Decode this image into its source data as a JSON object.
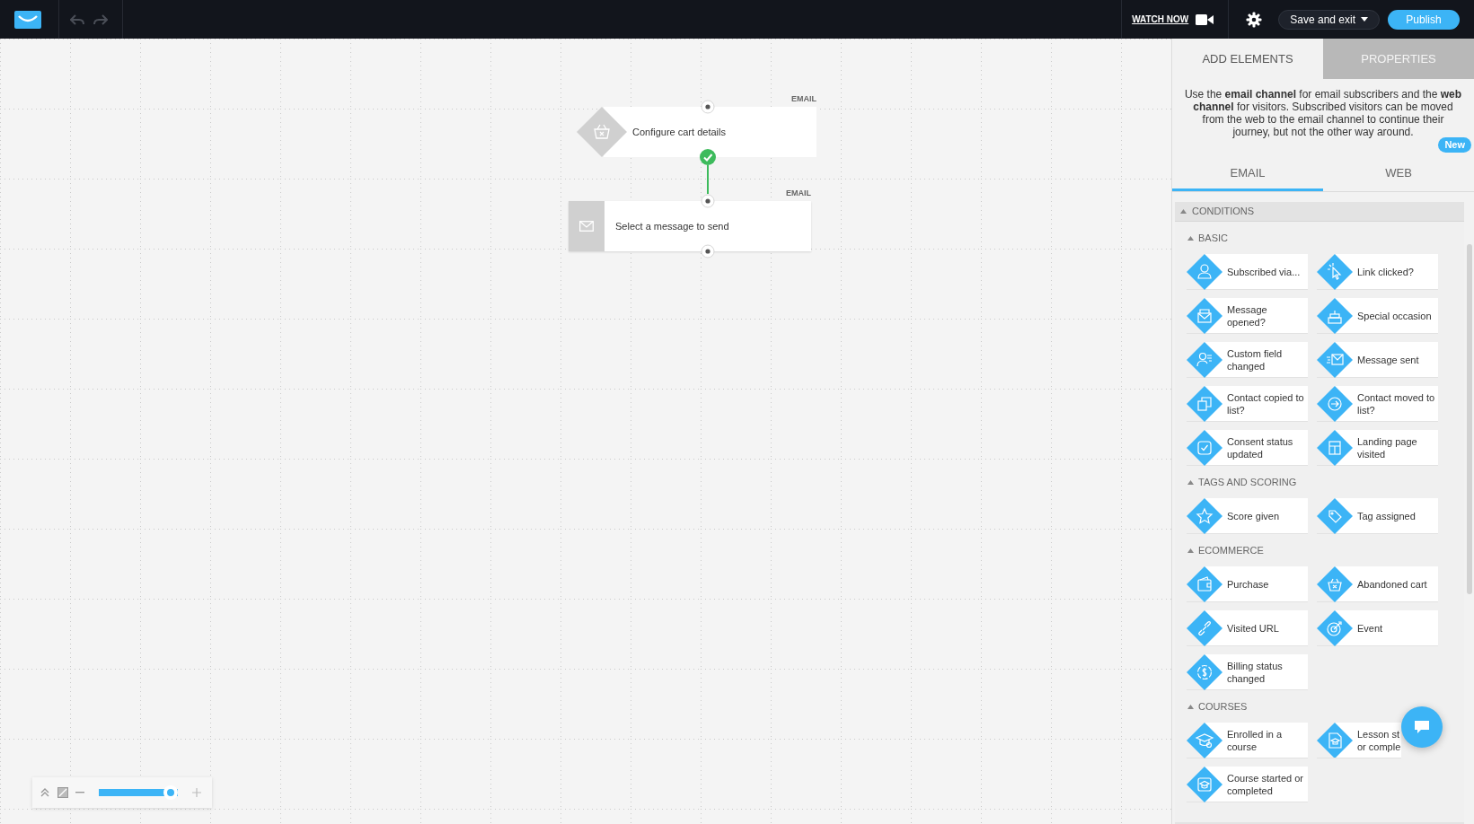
{
  "toolbar": {
    "watch_now": "WATCH NOW",
    "save_button": "Save and exit",
    "publish_button": "Publish"
  },
  "canvas": {
    "nodes": [
      {
        "kind": "condition",
        "label": "Configure cart details",
        "channel": "EMAIL",
        "completed": true
      },
      {
        "kind": "action",
        "label": "Select a message to send",
        "channel": "EMAIL",
        "completed": false
      }
    ]
  },
  "zoom_control": {
    "level": 1
  },
  "panel": {
    "tabs": [
      {
        "label": "ADD ELEMENTS",
        "selected": true
      },
      {
        "label": "PROPERTIES",
        "selected": false
      }
    ],
    "description": "Use the **email channel** for email subscribers and the **web channel** for visitors. Subscribed visitors can be moved from the web to the email channel to continue their journey, but not the other way around.",
    "channel_tabs": [
      {
        "label": "EMAIL",
        "selected": true
      },
      {
        "label": "WEB",
        "selected": false,
        "badge": "New"
      }
    ],
    "sections": [
      {
        "title": "CONDITIONS",
        "expanded": true,
        "groups": [
          {
            "title": "BASIC",
            "expanded": true,
            "items": [
              {
                "label": "Subscribed via..."
              },
              {
                "label": "Link clicked?"
              },
              {
                "label": "Message opened?"
              },
              {
                "label": "Special occasion"
              },
              {
                "label": "Custom field changed"
              },
              {
                "label": "Message sent"
              },
              {
                "label": "Contact copied to list?"
              },
              {
                "label": "Contact moved to list?"
              },
              {
                "label": "Consent status updated"
              },
              {
                "label": "Landing page visited"
              }
            ]
          },
          {
            "title": "TAGS AND SCORING",
            "expanded": true,
            "items": [
              {
                "label": "Score given"
              },
              {
                "label": "Tag assigned"
              }
            ]
          },
          {
            "title": "ECOMMERCE",
            "expanded": true,
            "items": [
              {
                "label": "Purchase"
              },
              {
                "label": "Abandoned cart"
              },
              {
                "label": "Visited URL"
              },
              {
                "label": "Event"
              },
              {
                "label": "Billing status changed"
              }
            ]
          },
          {
            "title": "COURSES",
            "expanded": true,
            "items": [
              {
                "label": "Enrolled in a course"
              },
              {
                "label": "Lesson st\nor comple"
              },
              {
                "label": "Course started or completed"
              }
            ]
          }
        ]
      }
    ]
  }
}
